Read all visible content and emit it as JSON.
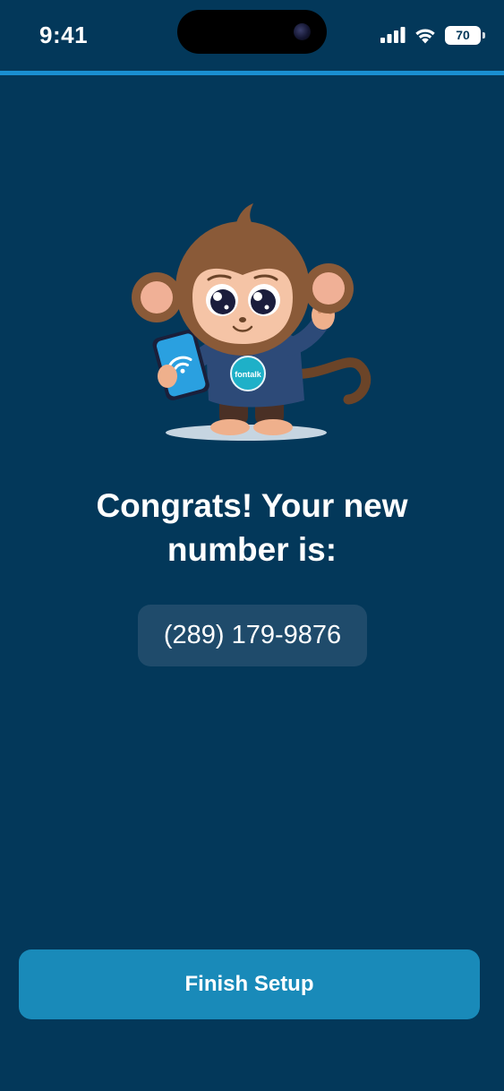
{
  "status_bar": {
    "time": "9:41",
    "battery_level": "70",
    "icons": [
      "cellular-signal-icon",
      "wifi-icon",
      "battery-icon"
    ]
  },
  "mascot": {
    "badge_text": "fontalk",
    "description_icon": "monkey-mascot-illustration"
  },
  "main": {
    "headline": "Congrats! Your new number is:",
    "phone_number": "(289) 179-9876"
  },
  "actions": {
    "finish_label": "Finish Setup"
  },
  "colors": {
    "background": "#03385a",
    "accent_line": "#1a8fd1",
    "pill": "#1f4b6b",
    "button": "#198ab9"
  }
}
